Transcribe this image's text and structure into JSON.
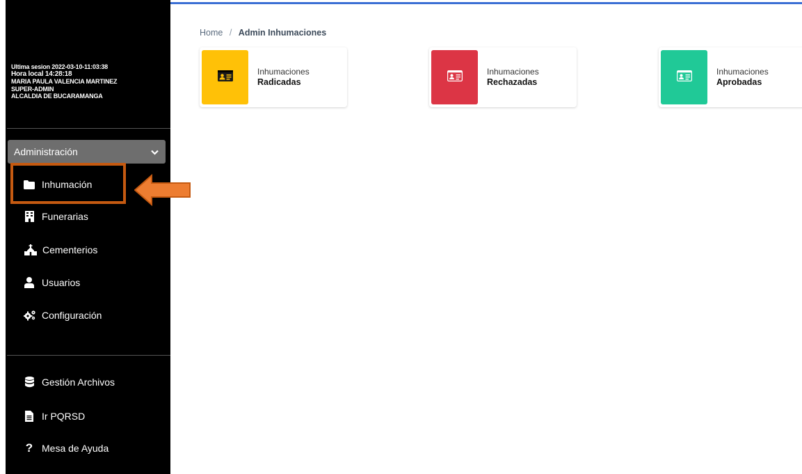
{
  "sidebar": {
    "session": {
      "last_session": "Ultima sesion 2022-03-10-11:03:38",
      "local_time": "Hora local 14:28:18",
      "user_name": "MARIA PAULA VALENCIA MARTINEZ",
      "role": "SUPER-ADMIN",
      "organization": "ALCALDIA DE BUCARAMANGA"
    },
    "menu_header": {
      "label": "Administración",
      "icon": "chevron-down-icon"
    },
    "admin_items": [
      {
        "label": "Inhumación",
        "icon": "folder-icon"
      },
      {
        "label": "Funerarias",
        "icon": "building-icon"
      },
      {
        "label": "Cementerios",
        "icon": "church-icon"
      },
      {
        "label": "Usuarios",
        "icon": "user-icon"
      },
      {
        "label": "Configuración",
        "icon": "gears-icon"
      }
    ],
    "bottom_items": [
      {
        "label": "Gestión Archivos",
        "icon": "database-icon"
      },
      {
        "label": "Ir PQRSD",
        "icon": "file-icon"
      },
      {
        "label": "Mesa de Ayuda",
        "icon": "question-icon"
      }
    ]
  },
  "annotation": {
    "color": "#c55a11",
    "arrow_color": "#ed7d31"
  },
  "breadcrumb": {
    "home": "Home",
    "separator": "/",
    "current": "Admin Inhumaciones"
  },
  "cards": [
    {
      "title": "Inhumaciones",
      "subtitle": "Radicadas",
      "color": "#ffc107",
      "icon": "id-card-icon"
    },
    {
      "title": "Inhumaciones",
      "subtitle": "Rechazadas",
      "color": "#dc3545",
      "icon": "id-card-icon"
    },
    {
      "title": "Inhumaciones",
      "subtitle": "Aprobadas",
      "color": "#20c997",
      "icon": "id-card-icon"
    }
  ],
  "colors": {
    "sidebar_bg": "#000000",
    "menu_header_bg": "#6e6e6e",
    "top_accent": "#3b6fd4"
  }
}
